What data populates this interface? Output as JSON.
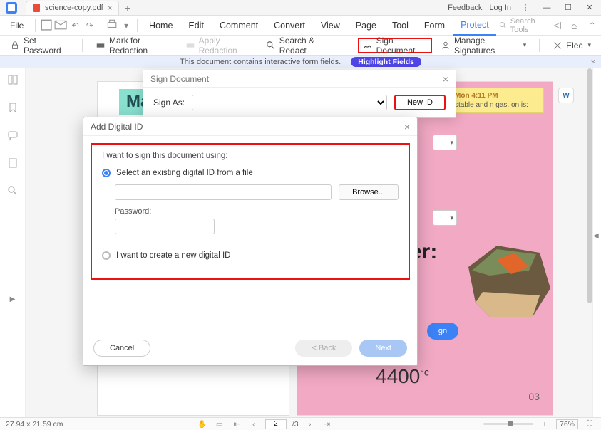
{
  "titlebar": {
    "tab_name": "science-copy.pdf",
    "feedback": "Feedback",
    "login": "Log In"
  },
  "menubar": {
    "file": "File",
    "items": [
      "Home",
      "Edit",
      "Comment",
      "Convert",
      "View",
      "Page",
      "Tool",
      "Form",
      "Protect"
    ],
    "search_placeholder": "Search Tools"
  },
  "toolbar": {
    "set_password": "Set Password",
    "mark_redaction": "Mark for Redaction",
    "apply_redaction": "Apply Redaction",
    "search_redact": "Search & Redact",
    "sign_document": "Sign Document",
    "manage_signatures": "Manage Signatures",
    "elec": "Elec"
  },
  "infobar": {
    "text": "This document contains interactive form fields.",
    "button": "Highlight Fields"
  },
  "document": {
    "matter": "Mat",
    "sticky_time": "Mon 4:11 PM",
    "sticky_text": "stable and n gas. on is:",
    "er": "er:",
    "sign": "gn",
    "temp": "4400",
    "temp_unit": "°c",
    "page_num": "03"
  },
  "sign_dialog": {
    "title": "Sign Document",
    "sign_as": "Sign As:",
    "new_id": "New ID"
  },
  "addid_dialog": {
    "title": "Add Digital ID",
    "prompt": "I want to sign this document using:",
    "opt_existing": "Select an existing digital ID from a file",
    "browse": "Browse...",
    "password": "Password:",
    "opt_new": "I want to create a new digital ID",
    "cancel": "Cancel",
    "back": "< Back",
    "next": "Next"
  },
  "statusbar": {
    "dims": "27.94 x 21.59 cm",
    "page_current": "2",
    "page_total": "/3",
    "zoom": "76%"
  }
}
